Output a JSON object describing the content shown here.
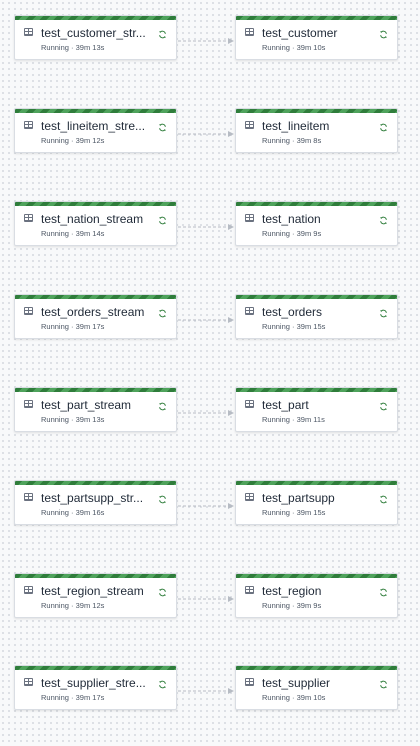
{
  "canvas": {
    "accent_color": "#2f7d3b",
    "status_color": "#2f7d3b"
  },
  "pipelines": [
    {
      "source": {
        "name": "test_customer_stream",
        "display": "test_customer_str...",
        "status": "Running · 39m 13s",
        "icon": "table-icon"
      },
      "sink": {
        "name": "test_customer",
        "display": "test_customer",
        "status": "Running · 39m 10s",
        "icon": "table-icon"
      }
    },
    {
      "source": {
        "name": "test_lineitem_stream",
        "display": "test_lineitem_stre...",
        "status": "Running · 39m 12s",
        "icon": "table-icon"
      },
      "sink": {
        "name": "test_lineitem",
        "display": "test_lineitem",
        "status": "Running · 39m 8s",
        "icon": "table-icon"
      }
    },
    {
      "source": {
        "name": "test_nation_stream",
        "display": "test_nation_stream",
        "status": "Running · 39m 14s",
        "icon": "table-icon"
      },
      "sink": {
        "name": "test_nation",
        "display": "test_nation",
        "status": "Running · 39m 9s",
        "icon": "table-icon"
      }
    },
    {
      "source": {
        "name": "test_orders_stream",
        "display": "test_orders_stream",
        "status": "Running · 39m 17s",
        "icon": "table-icon"
      },
      "sink": {
        "name": "test_orders",
        "display": "test_orders",
        "status": "Running · 39m 15s",
        "icon": "table-icon"
      }
    },
    {
      "source": {
        "name": "test_part_stream",
        "display": "test_part_stream",
        "status": "Running · 39m 13s",
        "icon": "table-icon"
      },
      "sink": {
        "name": "test_part",
        "display": "test_part",
        "status": "Running · 39m 11s",
        "icon": "table-icon"
      }
    },
    {
      "source": {
        "name": "test_partsupp_stream",
        "display": "test_partsupp_str...",
        "status": "Running · 39m 16s",
        "icon": "table-icon"
      },
      "sink": {
        "name": "test_partsupp",
        "display": "test_partsupp",
        "status": "Running · 39m 15s",
        "icon": "table-icon"
      }
    },
    {
      "source": {
        "name": "test_region_stream",
        "display": "test_region_stream",
        "status": "Running · 39m 12s",
        "icon": "table-icon"
      },
      "sink": {
        "name": "test_region",
        "display": "test_region",
        "status": "Running · 39m 9s",
        "icon": "table-icon"
      }
    },
    {
      "source": {
        "name": "test_supplier_stream",
        "display": "test_supplier_stre...",
        "status": "Running · 39m 17s",
        "icon": "table-icon"
      },
      "sink": {
        "name": "test_supplier",
        "display": "test_supplier",
        "status": "Running · 39m 10s",
        "icon": "table-icon"
      }
    }
  ]
}
